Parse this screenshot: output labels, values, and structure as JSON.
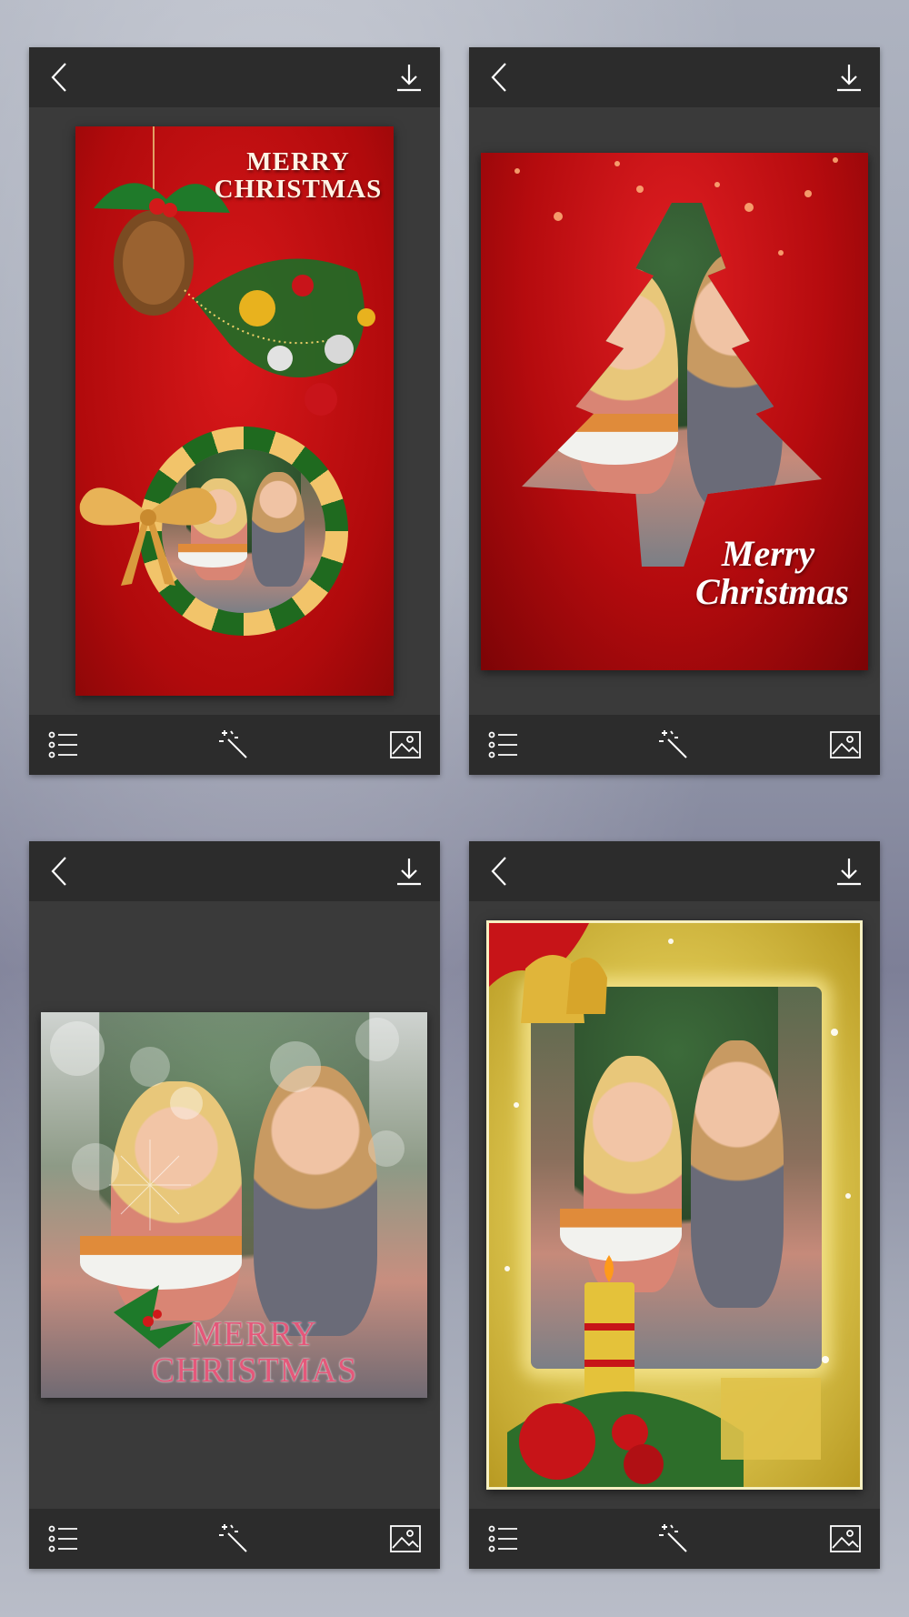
{
  "screens": [
    {
      "toolbar": {
        "back_icon": "chevron-left-icon",
        "download_icon": "download-icon"
      },
      "frame": {
        "style": "red-wreath",
        "greeting_line1": "MERRY",
        "greeting_line2": "CHRISTMAS"
      },
      "bottom": {
        "list_icon": "list-icon",
        "effects_icon": "magic-wand-icon",
        "gallery_icon": "image-icon"
      }
    },
    {
      "toolbar": {
        "back_icon": "chevron-left-icon",
        "download_icon": "download-icon"
      },
      "frame": {
        "style": "red-tree",
        "greeting_line1": "Merry",
        "greeting_line2": "Christmas"
      },
      "bottom": {
        "list_icon": "list-icon",
        "effects_icon": "magic-wand-icon",
        "gallery_icon": "image-icon"
      }
    },
    {
      "toolbar": {
        "back_icon": "chevron-left-icon",
        "download_icon": "download-icon"
      },
      "frame": {
        "style": "bokeh-square",
        "greeting_line1": "MERRY",
        "greeting_line2": "CHRISTMAS"
      },
      "bottom": {
        "list_icon": "list-icon",
        "effects_icon": "magic-wand-icon",
        "gallery_icon": "image-icon"
      }
    },
    {
      "toolbar": {
        "back_icon": "chevron-left-icon",
        "download_icon": "download-icon"
      },
      "frame": {
        "style": "gold-ornate"
      },
      "bottom": {
        "list_icon": "list-icon",
        "effects_icon": "magic-wand-icon",
        "gallery_icon": "image-icon"
      }
    }
  ],
  "colors": {
    "toolbar": "#2c2c2c",
    "panel": "#3a3a3a",
    "icon": "#ffffff",
    "red_frame": "#c40d10",
    "gold_frame": "#d8c04a"
  }
}
